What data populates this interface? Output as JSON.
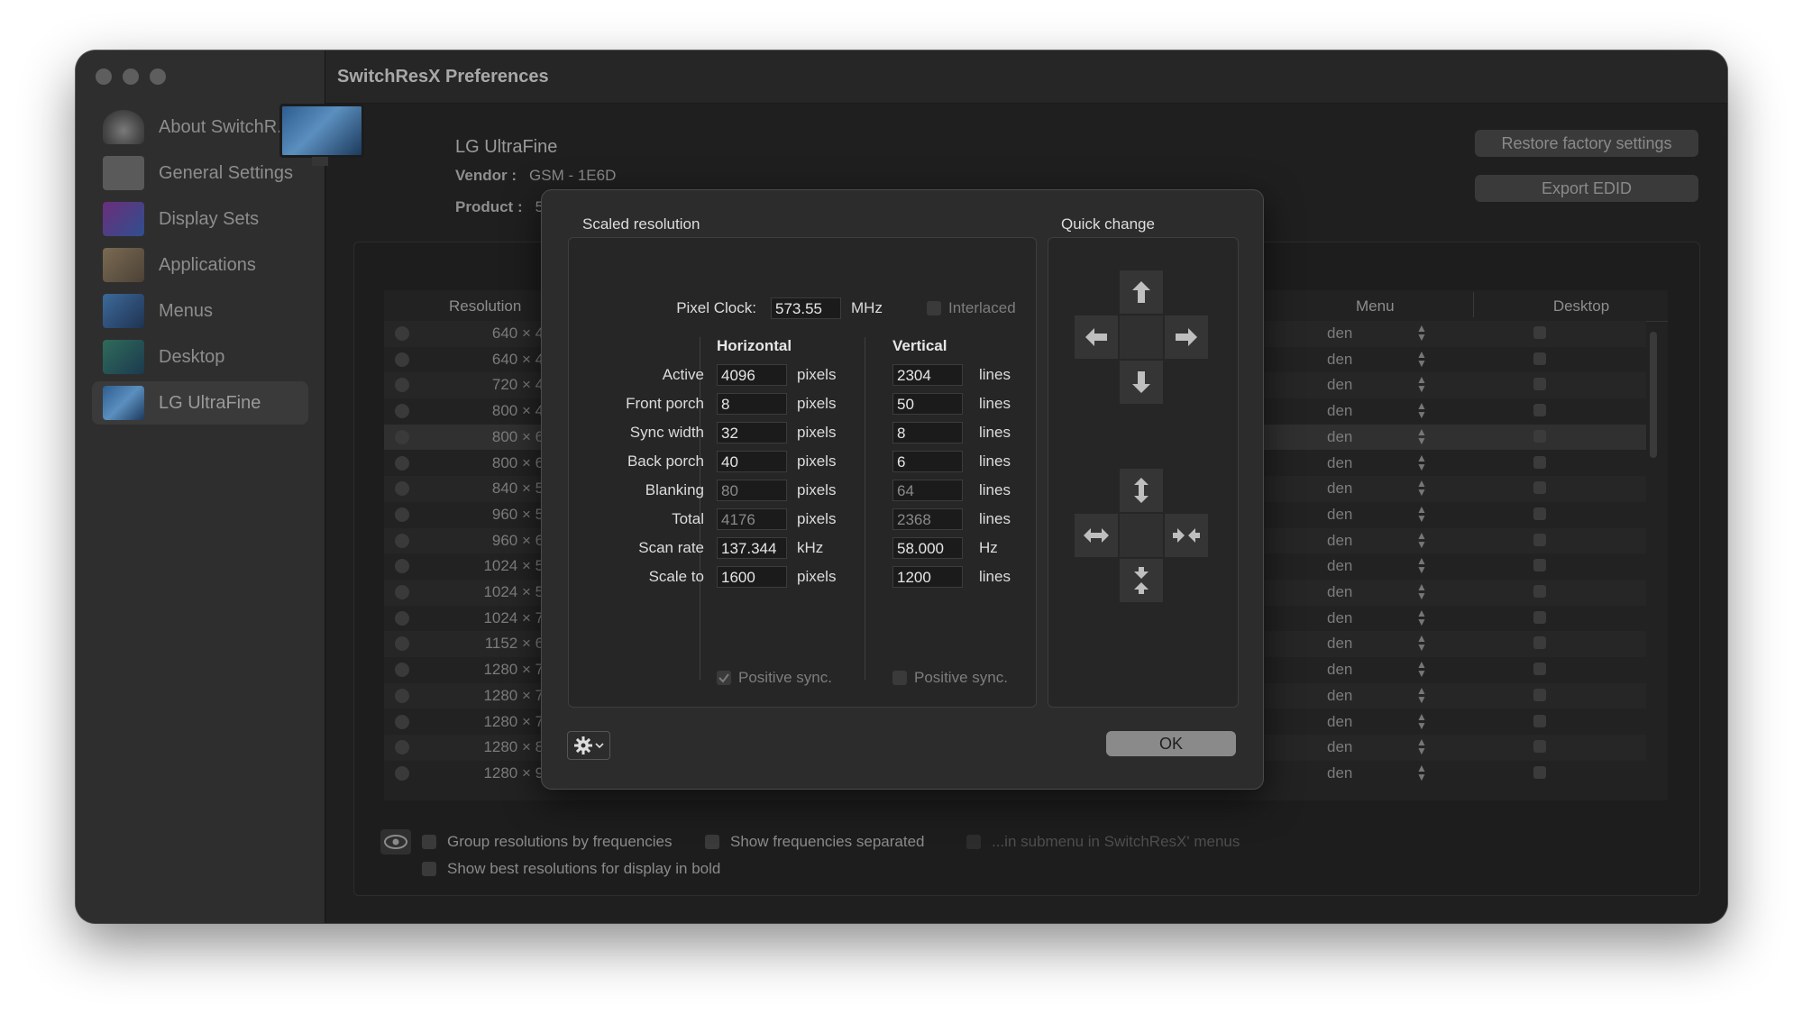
{
  "window": {
    "title": "SwitchResX Preferences"
  },
  "sidebar": {
    "items": [
      {
        "label": "About SwitchR...",
        "icon": "gauge-icon"
      },
      {
        "label": "General Settings",
        "icon": "switch-icon"
      },
      {
        "label": "Display Sets",
        "icon": "display-sets-icon"
      },
      {
        "label": "Applications",
        "icon": "applications-icon"
      },
      {
        "label": "Menus",
        "icon": "menus-icon"
      },
      {
        "label": "Desktop",
        "icon": "desktop-icon"
      },
      {
        "label": "LG UltraFine",
        "icon": "monitor-icon"
      }
    ]
  },
  "display": {
    "name": "LG UltraFine",
    "vendor_label": "Vendor :",
    "vendor_value": "GSM - 1E6D",
    "product_label": "Product :",
    "product_value": "5"
  },
  "buttons": {
    "restore": "Restore factory settings",
    "export": "Export EDID"
  },
  "table": {
    "headers": {
      "resolution": "Resolution",
      "menu": "Menu",
      "desktop": "Desktop"
    },
    "rows": [
      "640 × 480",
      "640 × 480",
      "720 × 450",
      "800 × 450",
      "800 × 600",
      "800 × 600",
      "840 × 525",
      "960 × 540",
      "960 × 600",
      "1024 × 576",
      "1024 × 576",
      "1024 × 768",
      "1152 × 648",
      "1280 × 720",
      "1280 × 720",
      "1280 × 720",
      "1280 × 800",
      "1280 × 960"
    ],
    "menu_value": "den"
  },
  "options": {
    "group": "Group resolutions by frequencies",
    "separated": "Show frequencies separated",
    "submenu": "...in submenu in SwitchResX' menus",
    "bold": "Show best resolutions for display in bold"
  },
  "dialog": {
    "scaled_title": "Scaled resolution",
    "quick_title": "Quick change",
    "pixel_clock_label": "Pixel Clock:",
    "pixel_clock_value": "573.55",
    "pixel_clock_unit": "MHz",
    "interlaced": "Interlaced",
    "horizontal": "Horizontal",
    "vertical": "Vertical",
    "rows": [
      {
        "label": "Active",
        "h": "4096",
        "hu": "pixels",
        "v": "2304",
        "vu": "lines",
        "dim": false
      },
      {
        "label": "Front porch",
        "h": "8",
        "hu": "pixels",
        "v": "50",
        "vu": "lines",
        "dim": false
      },
      {
        "label": "Sync width",
        "h": "32",
        "hu": "pixels",
        "v": "8",
        "vu": "lines",
        "dim": false
      },
      {
        "label": "Back porch",
        "h": "40",
        "hu": "pixels",
        "v": "6",
        "vu": "lines",
        "dim": false
      },
      {
        "label": "Blanking",
        "h": "80",
        "hu": "pixels",
        "v": "64",
        "vu": "lines",
        "dim": true
      },
      {
        "label": "Total",
        "h": "4176",
        "hu": "pixels",
        "v": "2368",
        "vu": "lines",
        "dim": true
      },
      {
        "label": "Scan rate",
        "h": "137.344",
        "hu": "kHz",
        "v": "58.000",
        "vu": "Hz",
        "dim": false
      },
      {
        "label": "Scale to",
        "h": "1600",
        "hu": "pixels",
        "v": "1200",
        "vu": "lines",
        "dim": false
      }
    ],
    "positive_sync": "Positive sync.",
    "ok": "OK"
  }
}
